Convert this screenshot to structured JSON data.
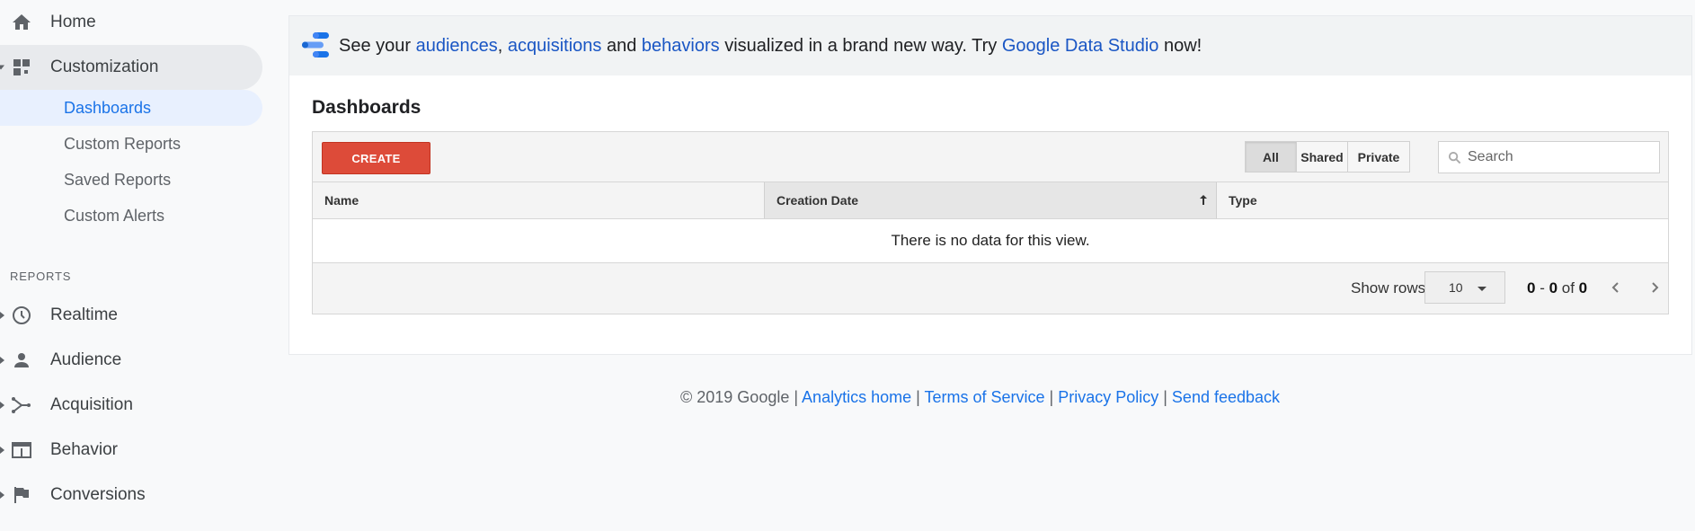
{
  "sidebar": {
    "home": {
      "label": "Home",
      "icon": "home-icon"
    },
    "customization": {
      "label": "Customization",
      "icon": "dashboard-grid-icon",
      "items": [
        {
          "label": "Dashboards",
          "selected": true
        },
        {
          "label": "Custom Reports"
        },
        {
          "label": "Saved Reports"
        },
        {
          "label": "Custom Alerts"
        }
      ]
    },
    "reports_heading": "REPORTS",
    "reports": [
      {
        "label": "Realtime",
        "icon": "clock-icon"
      },
      {
        "label": "Audience",
        "icon": "person-icon"
      },
      {
        "label": "Acquisition",
        "icon": "acquisition-icon"
      },
      {
        "label": "Behavior",
        "icon": "behavior-icon"
      },
      {
        "label": "Conversions",
        "icon": "flag-icon"
      }
    ]
  },
  "banner": {
    "part1": "See your ",
    "link1": "audiences",
    "part2": ", ",
    "link2": "acquisitions",
    "part3": " and ",
    "link3": "behaviors",
    "part4": " visualized in a brand new way. Try ",
    "link4": "Google Data Studio",
    "part5": " now!"
  },
  "page": {
    "title": "Dashboards"
  },
  "toolbar": {
    "create_label": "CREATE",
    "filters": [
      "All",
      "Shared",
      "Private"
    ],
    "active_filter": "All",
    "search_placeholder": "Search"
  },
  "table": {
    "columns": [
      "Name",
      "Creation Date",
      "Type"
    ],
    "sorted_column": "Creation Date",
    "empty_message": "There is no data for this view."
  },
  "pagination": {
    "show_rows_label": "Show rows",
    "rows_value": "10",
    "range_start": "0",
    "range_sep": " - ",
    "range_end": "0",
    "of_label": " of ",
    "total": "0"
  },
  "footer": {
    "copyright": "© 2019 Google",
    "sep": " | ",
    "links": [
      "Analytics home",
      "Terms of Service",
      "Privacy Policy",
      "Send feedback"
    ]
  },
  "colors": {
    "accent_blue": "#1a73e8",
    "create_red": "#dd4b39",
    "selected_bg": "#e8f0fe"
  }
}
